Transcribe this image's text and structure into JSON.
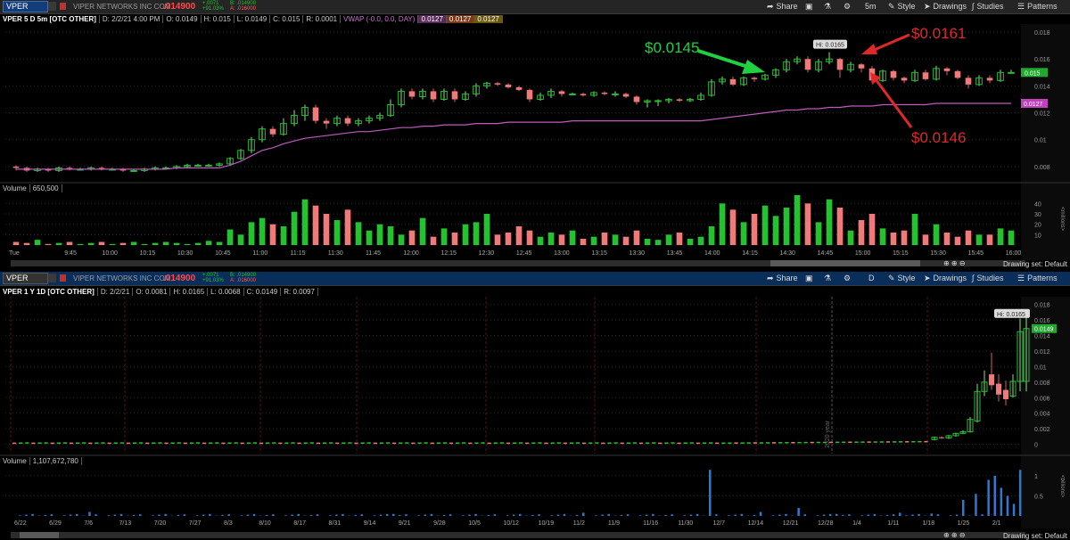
{
  "colors": {
    "up": "#22c32e",
    "down": "#f07a7a",
    "vwap": "#c05ac0",
    "grid": "#3a1a1a",
    "annot_green": "#20d040",
    "annot_red": "#e02828"
  },
  "header": {
    "symbol": "VPER",
    "company": "VIPER NETWORKS INC COM",
    "price": ".014900",
    "chg1": "+.0071",
    "chg2": "+91.03%",
    "bid": "B: .014900",
    "ask": "A: .016000",
    "buttons": {
      "share": "Share",
      "timeframe": "5m",
      "style": "Style",
      "drawings": "Drawings",
      "studies": "Studies",
      "patterns": "Patterns"
    }
  },
  "chart1": {
    "title": "VPER 5 D 5m [OTC OTHER]",
    "date": "D: 2/2/21 4:00 PM",
    "o": "O: 0.0149",
    "h": "H: 0.015",
    "l": "L: 0.0149",
    "c": "C: 0.015",
    "r": "R: 0.0001",
    "vwap": "VWAP (-0.0, 0.0, DAY)",
    "vwap_v1": "0.0127",
    "vwap_v2": "0.0127",
    "vwap_v3": "0.0127",
    "last_price_box": "0.015",
    "vwap_box": "0.0127",
    "hi_label": "Hi: 0.0165",
    "volume_label": "Volume",
    "volume_value": "650,500",
    "drawing_set": "Drawing set: Default",
    "annotations": {
      "a1": "$0.0145",
      "a2": "$0.0161",
      "a3": "$0.0146"
    },
    "y_ticks": [
      "0.018",
      "0.016",
      "0.014",
      "0.012",
      "0.01",
      "0.008"
    ],
    "vol_ticks": [
      "40",
      "30",
      "20",
      "10"
    ],
    "vol_unit": "<millions>"
  },
  "chart2": {
    "symbol": "VPER",
    "title": "VPER 1 Y 1D [OTC OTHER]",
    "date": "D: 2/2/21",
    "o": "O: 0.0081",
    "h": "H: 0.0165",
    "l": "L: 0.0068",
    "c": "C: 0.0149",
    "r": "R: 0.0097",
    "timeframe": "D",
    "last_price_box": "0.0149",
    "hi_label": "Hi: 0.0165",
    "volume_label": "Volume",
    "volume_value": "1,107,672,780",
    "drawing_set": "Drawing set: Default",
    "y_ticks": [
      "0.018",
      "0.016",
      "0.014",
      "0.012",
      "0.01",
      "0.008",
      "0.006",
      "0.004",
      "0.002",
      "0"
    ],
    "vol_ticks": [
      "1",
      "0.5"
    ],
    "vol_unit": "<billions>",
    "year_marker": "2020 year"
  },
  "chart_data": [
    {
      "type": "candlestick",
      "title": "VPER 5 D 5m [OTC OTHER]",
      "x": [
        "Tue",
        "9:45",
        "10:00",
        "10:15",
        "10:30",
        "10:45",
        "11:00",
        "11:15",
        "11:30",
        "11:45",
        "12:00",
        "12:15",
        "12:30",
        "12:45",
        "13:00",
        "13:15",
        "13:30",
        "13:45",
        "14:00",
        "14:15",
        "14:30",
        "14:45",
        "15:00",
        "15:15",
        "15:30",
        "15:45",
        "16:00"
      ],
      "ylim": [
        0.0068,
        0.0186
      ],
      "candles": [
        [
          0.008,
          0.0079,
          0.0081,
          0.0077
        ],
        [
          0.0079,
          0.0077,
          0.008,
          0.0076
        ],
        [
          0.0077,
          0.0078,
          0.0079,
          0.0076
        ],
        [
          0.0078,
          0.0077,
          0.0079,
          0.0076
        ],
        [
          0.0077,
          0.0079,
          0.008,
          0.0076
        ],
        [
          0.0079,
          0.0078,
          0.008,
          0.0077
        ],
        [
          0.0078,
          0.0078,
          0.0079,
          0.0077
        ],
        [
          0.0078,
          0.0079,
          0.008,
          0.0077
        ],
        [
          0.0079,
          0.0078,
          0.008,
          0.0077
        ],
        [
          0.0078,
          0.0078,
          0.0079,
          0.0077
        ],
        [
          0.0078,
          0.0077,
          0.0079,
          0.0076
        ],
        [
          0.0077,
          0.0077,
          0.0078,
          0.0076
        ],
        [
          0.0077,
          0.0078,
          0.0079,
          0.0076
        ],
        [
          0.0078,
          0.0079,
          0.008,
          0.0077
        ],
        [
          0.0079,
          0.0079,
          0.008,
          0.0078
        ],
        [
          0.0079,
          0.008,
          0.0081,
          0.0078
        ],
        [
          0.008,
          0.0081,
          0.0082,
          0.0079
        ],
        [
          0.0081,
          0.0081,
          0.0082,
          0.008
        ],
        [
          0.0081,
          0.0081,
          0.0082,
          0.008
        ],
        [
          0.0081,
          0.0082,
          0.0083,
          0.008
        ],
        [
          0.0082,
          0.0086,
          0.0087,
          0.0081
        ],
        [
          0.0086,
          0.0092,
          0.0093,
          0.0085
        ],
        [
          0.0092,
          0.01,
          0.0102,
          0.009
        ],
        [
          0.01,
          0.0108,
          0.011,
          0.0098
        ],
        [
          0.0108,
          0.0104,
          0.011,
          0.0102
        ],
        [
          0.0104,
          0.0112,
          0.0116,
          0.0103
        ],
        [
          0.0112,
          0.0118,
          0.0122,
          0.011
        ],
        [
          0.0118,
          0.0124,
          0.0126,
          0.0114
        ],
        [
          0.0124,
          0.0114,
          0.0126,
          0.0112
        ],
        [
          0.0114,
          0.0112,
          0.0116,
          0.0108
        ],
        [
          0.0112,
          0.0116,
          0.0118,
          0.011
        ],
        [
          0.0116,
          0.0112,
          0.0118,
          0.011
        ],
        [
          0.0112,
          0.0114,
          0.0116,
          0.011
        ],
        [
          0.0114,
          0.0116,
          0.0118,
          0.0112
        ],
        [
          0.0116,
          0.0118,
          0.012,
          0.0114
        ],
        [
          0.0118,
          0.0126,
          0.013,
          0.0117
        ],
        [
          0.0126,
          0.0136,
          0.0138,
          0.0124
        ],
        [
          0.0136,
          0.0132,
          0.0138,
          0.013
        ],
        [
          0.0132,
          0.0136,
          0.0138,
          0.013
        ],
        [
          0.0136,
          0.013,
          0.0138,
          0.0128
        ],
        [
          0.013,
          0.0136,
          0.0138,
          0.0129
        ],
        [
          0.0136,
          0.013,
          0.0138,
          0.0128
        ],
        [
          0.013,
          0.0134,
          0.0136,
          0.0129
        ],
        [
          0.0134,
          0.014,
          0.0142,
          0.0132
        ],
        [
          0.014,
          0.0142,
          0.0143,
          0.0138
        ],
        [
          0.0142,
          0.0141,
          0.0143,
          0.014
        ],
        [
          0.0141,
          0.0139,
          0.0142,
          0.0138
        ],
        [
          0.0139,
          0.0137,
          0.014,
          0.0136
        ],
        [
          0.0137,
          0.013,
          0.0138,
          0.0128
        ],
        [
          0.013,
          0.0133,
          0.0135,
          0.0129
        ],
        [
          0.0133,
          0.0136,
          0.0138,
          0.0131
        ],
        [
          0.0136,
          0.0134,
          0.0137,
          0.0132
        ],
        [
          0.0134,
          0.0134,
          0.0135,
          0.0133
        ],
        [
          0.0134,
          0.0133,
          0.0135,
          0.0132
        ],
        [
          0.0133,
          0.0135,
          0.0136,
          0.0132
        ],
        [
          0.0135,
          0.0134,
          0.0136,
          0.0133
        ],
        [
          0.0134,
          0.0134,
          0.0136,
          0.0132
        ],
        [
          0.0134,
          0.0132,
          0.0135,
          0.0131
        ],
        [
          0.0132,
          0.0128,
          0.0133,
          0.0126
        ],
        [
          0.0128,
          0.0129,
          0.013,
          0.0124
        ],
        [
          0.0129,
          0.0129,
          0.013,
          0.0125
        ],
        [
          0.0129,
          0.013,
          0.0131,
          0.0127
        ],
        [
          0.013,
          0.0129,
          0.0131,
          0.0128
        ],
        [
          0.0129,
          0.013,
          0.0131,
          0.0128
        ],
        [
          0.013,
          0.0133,
          0.0135,
          0.0129
        ],
        [
          0.0133,
          0.0143,
          0.0145,
          0.0132
        ],
        [
          0.0143,
          0.0145,
          0.0147,
          0.0141
        ],
        [
          0.0145,
          0.0141,
          0.0147,
          0.014
        ],
        [
          0.0141,
          0.0146,
          0.0147,
          0.014
        ],
        [
          0.0146,
          0.0145,
          0.0147,
          0.0143
        ],
        [
          0.0145,
          0.0148,
          0.0149,
          0.0144
        ],
        [
          0.0148,
          0.0152,
          0.0153,
          0.0146
        ],
        [
          0.0152,
          0.0158,
          0.016,
          0.015
        ],
        [
          0.0158,
          0.016,
          0.0162,
          0.0156
        ],
        [
          0.016,
          0.0152,
          0.0162,
          0.015
        ],
        [
          0.0152,
          0.0158,
          0.016,
          0.015
        ],
        [
          0.0158,
          0.016,
          0.0165,
          0.0156
        ],
        [
          0.016,
          0.0152,
          0.0161,
          0.0146
        ],
        [
          0.0152,
          0.0156,
          0.0158,
          0.015
        ],
        [
          0.0156,
          0.0153,
          0.0157,
          0.015
        ],
        [
          0.0153,
          0.0144,
          0.0155,
          0.0142
        ],
        [
          0.0144,
          0.0151,
          0.0152,
          0.0143
        ],
        [
          0.0151,
          0.0146,
          0.0152,
          0.0144
        ],
        [
          0.0146,
          0.0144,
          0.0147,
          0.0142
        ],
        [
          0.0144,
          0.015,
          0.0152,
          0.0143
        ],
        [
          0.015,
          0.0145,
          0.0152,
          0.0144
        ],
        [
          0.0145,
          0.0153,
          0.0155,
          0.0144
        ],
        [
          0.0153,
          0.0151,
          0.0154,
          0.0148
        ],
        [
          0.0151,
          0.0146,
          0.0152,
          0.0145
        ],
        [
          0.0146,
          0.0141,
          0.0148,
          0.0138
        ],
        [
          0.0141,
          0.0146,
          0.0148,
          0.014
        ],
        [
          0.0146,
          0.0144,
          0.0148,
          0.0142
        ],
        [
          0.0144,
          0.015,
          0.0152,
          0.0143
        ],
        [
          0.015,
          0.015,
          0.0152,
          0.0149
        ]
      ],
      "vwap": [
        0.0078,
        0.0078,
        0.0078,
        0.0078,
        0.0078,
        0.0078,
        0.0078,
        0.0078,
        0.0078,
        0.0078,
        0.0078,
        0.0078,
        0.0078,
        0.0078,
        0.0078,
        0.0079,
        0.0079,
        0.0079,
        0.0079,
        0.0079,
        0.0081,
        0.0084,
        0.0088,
        0.0092,
        0.0094,
        0.0097,
        0.0099,
        0.0101,
        0.0102,
        0.0103,
        0.0104,
        0.0105,
        0.0106,
        0.0106,
        0.0107,
        0.0108,
        0.0109,
        0.0109,
        0.011,
        0.011,
        0.0111,
        0.0111,
        0.0111,
        0.0112,
        0.0112,
        0.0112,
        0.0113,
        0.0113,
        0.0113,
        0.0113,
        0.0113,
        0.0113,
        0.0114,
        0.0114,
        0.0114,
        0.0114,
        0.0114,
        0.0114,
        0.0114,
        0.0114,
        0.0114,
        0.0114,
        0.0114,
        0.0114,
        0.0114,
        0.0115,
        0.0116,
        0.0117,
        0.0118,
        0.0119,
        0.012,
        0.0121,
        0.0122,
        0.0122,
        0.0123,
        0.0123,
        0.0124,
        0.0124,
        0.0125,
        0.0125,
        0.0125,
        0.0126,
        0.0126,
        0.0126,
        0.0126,
        0.0126,
        0.0127,
        0.0127,
        0.0127,
        0.0127,
        0.0127,
        0.0127,
        0.0127,
        0.0127
      ],
      "volume": [
        3,
        2,
        5,
        1,
        2,
        3,
        1,
        2,
        3,
        1,
        2,
        3,
        1,
        2,
        3,
        2,
        1,
        2,
        4,
        3,
        15,
        10,
        22,
        26,
        20,
        18,
        32,
        44,
        38,
        30,
        24,
        34,
        22,
        14,
        20,
        18,
        10,
        14,
        26,
        8,
        16,
        12,
        20,
        22,
        30,
        10,
        12,
        18,
        14,
        8,
        12,
        10,
        14,
        6,
        8,
        12,
        10,
        8,
        14,
        6,
        5,
        10,
        12,
        6,
        8,
        18,
        40,
        34,
        22,
        30,
        38,
        28,
        36,
        48,
        40,
        22,
        44,
        36,
        14,
        24,
        30,
        16,
        12,
        14,
        30,
        10,
        20,
        12,
        8,
        14,
        10,
        10,
        16,
        14
      ]
    },
    {
      "type": "candlestick",
      "title": "VPER 1 Y 1D [OTC OTHER]",
      "x": [
        "6/22",
        "6/29",
        "7/6",
        "7/13",
        "7/20",
        "7/27",
        "8/3",
        "8/10",
        "8/17",
        "8/31",
        "9/14",
        "9/21",
        "9/28",
        "10/5",
        "10/12",
        "10/19",
        "11/2",
        "11/9",
        "11/16",
        "11/30",
        "12/7",
        "12/14",
        "12/21",
        "12/28",
        "1/4",
        "1/11",
        "1/18",
        "1/25",
        "2/1"
      ],
      "ylim": [
        -0.0012,
        0.019
      ],
      "volume_unit": "billions"
    }
  ]
}
